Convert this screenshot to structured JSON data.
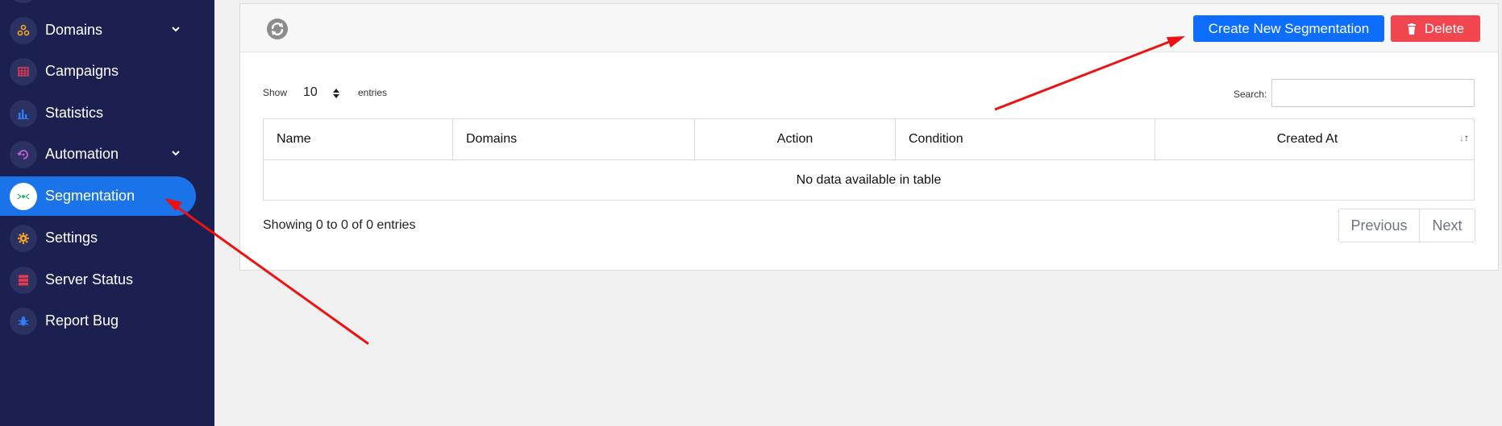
{
  "sidebar": {
    "items": [
      {
        "label": "Domains",
        "has_chevron": true,
        "active": false
      },
      {
        "label": "Campaigns",
        "has_chevron": false,
        "active": false
      },
      {
        "label": "Statistics",
        "has_chevron": false,
        "active": false
      },
      {
        "label": "Automation",
        "has_chevron": true,
        "active": false
      },
      {
        "label": "Segmentation",
        "has_chevron": false,
        "active": true
      },
      {
        "label": "Settings",
        "has_chevron": false,
        "active": false
      },
      {
        "label": "Server Status",
        "has_chevron": false,
        "active": false
      },
      {
        "label": "Report Bug",
        "has_chevron": false,
        "active": false
      }
    ]
  },
  "toolbar": {
    "create_label": "Create New Segmentation",
    "delete_label": "Delete"
  },
  "table_controls": {
    "show_label": "Show",
    "entries_value": "10",
    "entries_label": "entries",
    "search_label": "Search:",
    "search_value": ""
  },
  "table": {
    "columns": [
      "Name",
      "Domains",
      "Action",
      "Condition",
      "Created At"
    ],
    "empty_message": "No data available in table"
  },
  "footer": {
    "showing_text": "Showing 0 to 0 of 0 entries",
    "previous_label": "Previous",
    "next_label": "Next"
  },
  "colors": {
    "sidebar_bg": "#1b2050",
    "active_item": "#1a73e8",
    "primary_button": "#0d6efd",
    "danger_button": "#f1464f",
    "annotation_arrow": "#ee1111"
  },
  "icons": {
    "domains": "domains-icon",
    "campaigns": "campaigns-icon",
    "statistics": "statistics-icon",
    "automation": "automation-icon",
    "segmentation": "segmentation-icon",
    "settings": "gear-icon",
    "server_status": "server-icon",
    "report_bug": "bug-icon",
    "refresh": "refresh-icon",
    "delete": "trash-icon"
  }
}
